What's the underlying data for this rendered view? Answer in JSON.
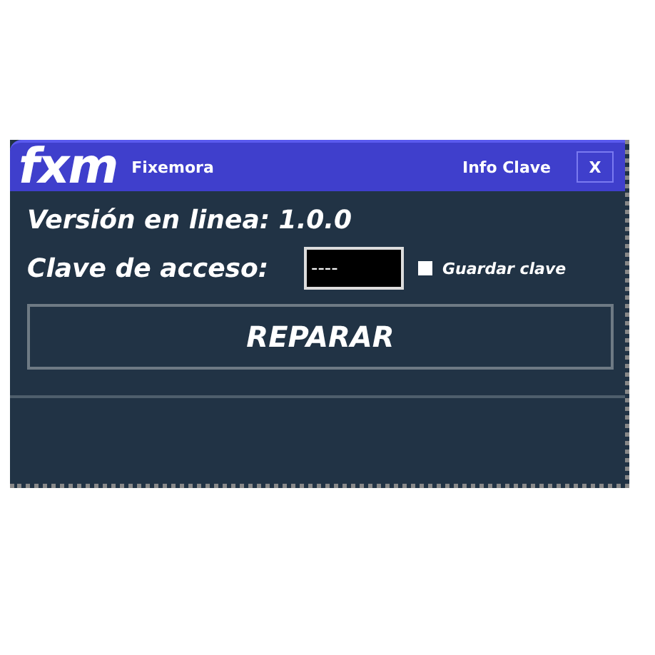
{
  "title_bar": {
    "logo": "fxm",
    "title": "Fixemora",
    "info_link": "Info Clave",
    "close_button": "X"
  },
  "version": {
    "label": "Versión en linea: 1.0.0"
  },
  "access": {
    "label": "Clave de acceso:",
    "value": "----"
  },
  "save_key": {
    "label": "Guardar clave",
    "checked": false
  },
  "repair_button": "REPARAR"
}
